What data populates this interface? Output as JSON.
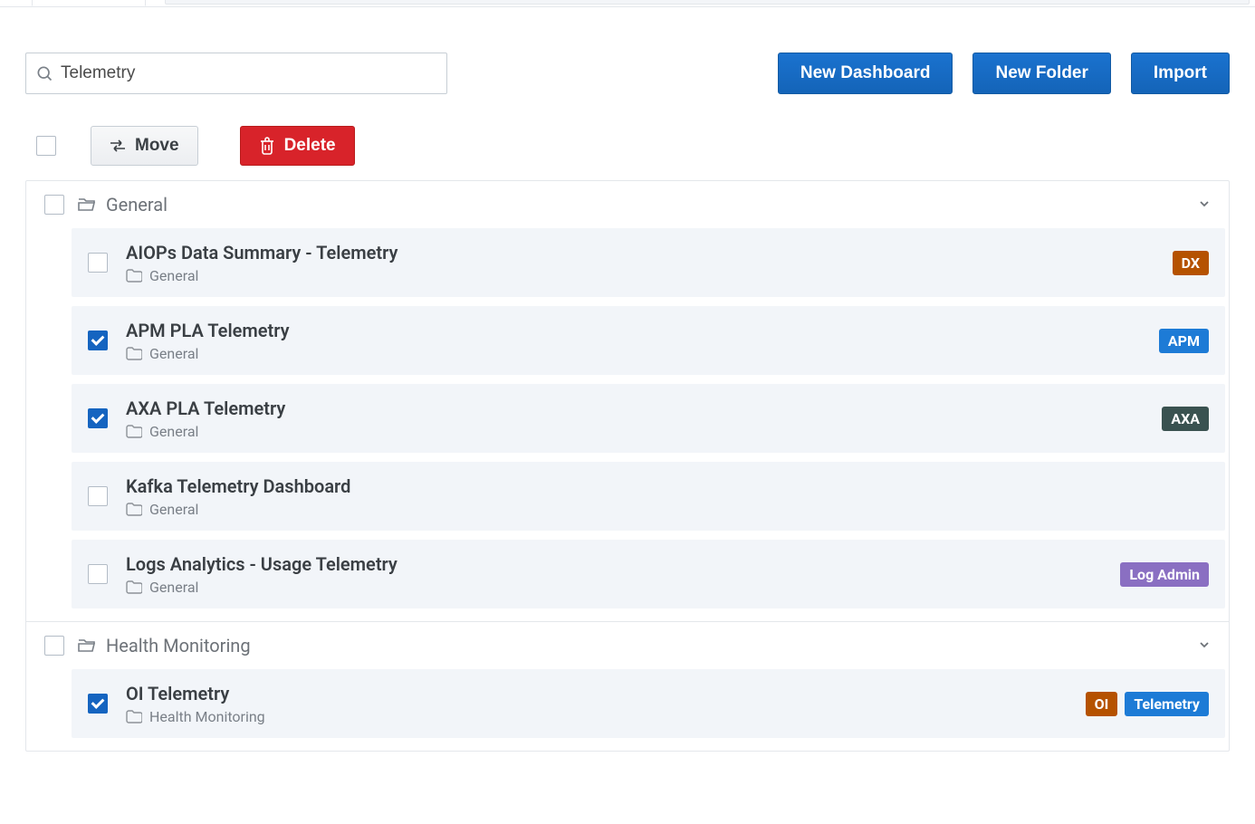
{
  "search": {
    "value": "Telemetry"
  },
  "actions": {
    "new_dashboard": "New Dashboard",
    "new_folder": "New Folder",
    "import": "Import",
    "move": "Move",
    "delete": "Delete"
  },
  "folders": [
    {
      "name": "General",
      "items": [
        {
          "title": "AIOPs Data Summary - Telemetry",
          "folder": "General",
          "checked": false,
          "tags": [
            {
              "text": "DX",
              "color": "#b55200"
            }
          ]
        },
        {
          "title": "APM PLA Telemetry",
          "folder": "General",
          "checked": true,
          "tags": [
            {
              "text": "APM",
              "color": "#1d7bd6"
            }
          ]
        },
        {
          "title": "AXA PLA Telemetry",
          "folder": "General",
          "checked": true,
          "tags": [
            {
              "text": "AXA",
              "color": "#3a5250"
            }
          ]
        },
        {
          "title": "Kafka Telemetry Dashboard",
          "folder": "General",
          "checked": false,
          "tags": []
        },
        {
          "title": "Logs Analytics - Usage Telemetry",
          "folder": "General",
          "checked": false,
          "tags": [
            {
              "text": "Log Admin",
              "color": "#8a6fc2"
            }
          ]
        }
      ]
    },
    {
      "name": "Health Monitoring",
      "items": [
        {
          "title": "OI Telemetry",
          "folder": "Health Monitoring",
          "checked": true,
          "tags": [
            {
              "text": "OI",
              "color": "#b55200"
            },
            {
              "text": "Telemetry",
              "color": "#1d7bd6"
            }
          ]
        }
      ]
    }
  ]
}
